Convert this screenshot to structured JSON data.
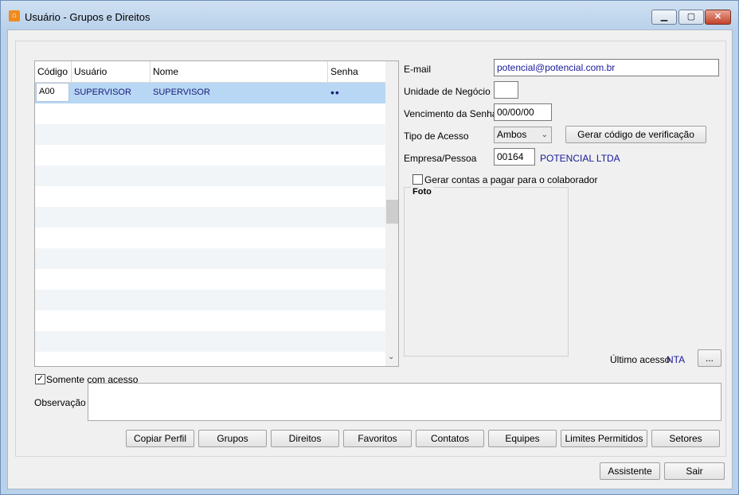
{
  "window": {
    "title": "Usuário - Grupos e Direitos",
    "controls": {
      "minimize": "▁",
      "maximize": "▢",
      "close": "✕"
    }
  },
  "grid": {
    "columns": [
      "Código",
      "Usuário",
      "Nome",
      "Senha"
    ],
    "rows": [
      {
        "codigo": "A00",
        "usuario": "SUPERVISOR",
        "nome": "SUPERVISOR",
        "senha": "••"
      }
    ]
  },
  "form": {
    "email_label": "E-mail",
    "email_value": "potencial@potencial.com.br",
    "unidade_label": "Unidade de Negócio",
    "unidade_value": "",
    "vencimento_label": "Vencimento da Senha",
    "vencimento_value": "00/00/00",
    "tipo_label": "Tipo de Acesso",
    "tipo_value": "Ambos",
    "gerar_codigo_button": "Gerar código de verificação",
    "empresa_label": "Empresa/Pessoa",
    "empresa_code": "00164",
    "empresa_name": "POTENCIAL LTDA",
    "gerar_contas_label": "Gerar contas a pagar para o colaborador",
    "foto_label": "Foto",
    "ultimo_acesso_label": "Último acesso",
    "ultimo_acesso_value": "NTA",
    "more_button": "...",
    "somente_label": "Somente com acesso",
    "observacao_label": "Observação"
  },
  "buttons": {
    "copiar": "Copiar Perfil",
    "grupos": "Grupos",
    "direitos": "Direitos",
    "favoritos": "Favoritos",
    "contatos": "Contatos",
    "equipes": "Equipes",
    "limites": "Limites Permitidos",
    "setores": "Setores",
    "assistente": "Assistente",
    "sair": "Sair"
  }
}
